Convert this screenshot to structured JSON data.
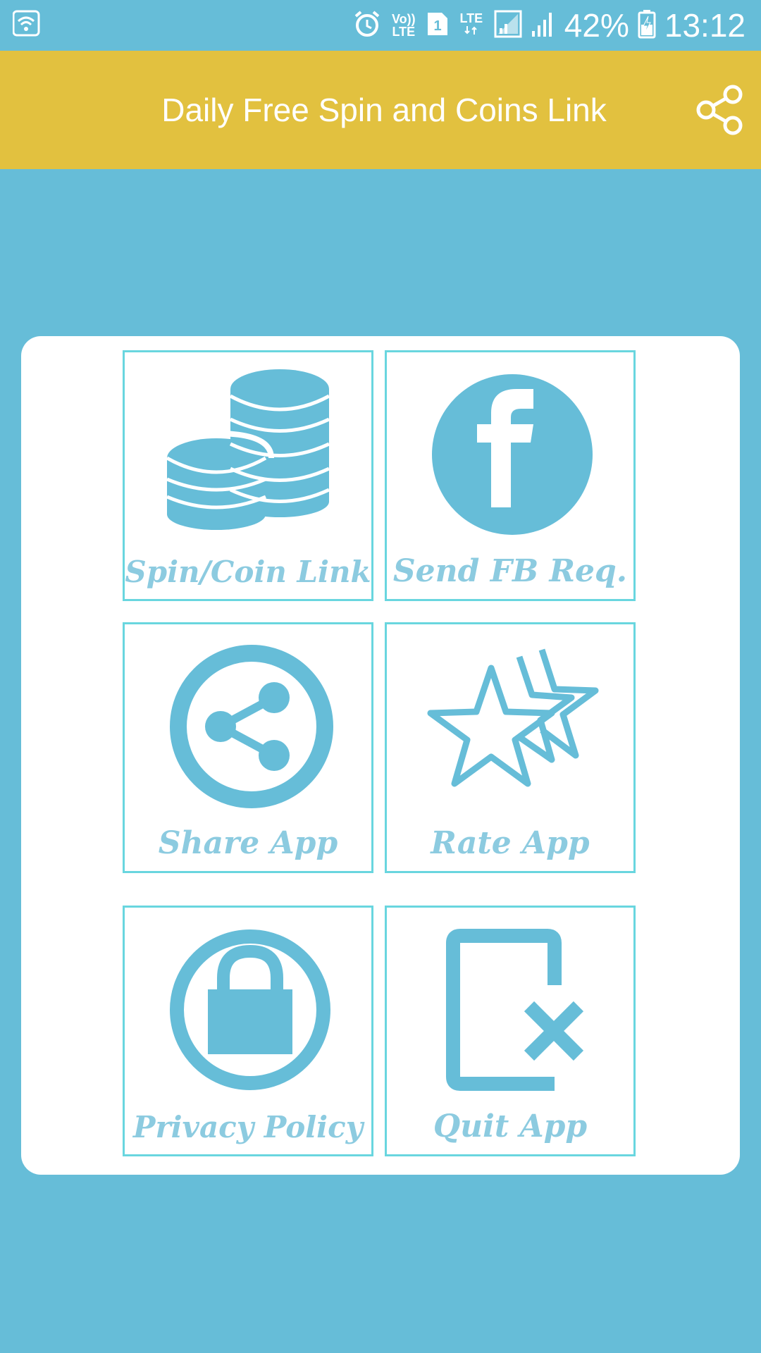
{
  "status_bar": {
    "network_label_top": "Vo))",
    "network_label_bottom": "LTE",
    "sim_slot": "1",
    "lte_label": "LTE",
    "battery_percent": "42%",
    "time": "13:12"
  },
  "app_bar": {
    "title": "Daily Free Spin and Coins Link",
    "share_icon": "share-icon"
  },
  "menu": {
    "items": [
      {
        "label": "Spin/Coin Link",
        "icon": "coins-icon"
      },
      {
        "label": "Send FB Req.",
        "icon": "facebook-icon"
      },
      {
        "label": "Share App",
        "icon": "share-circle-icon"
      },
      {
        "label": "Rate App",
        "icon": "stars-icon"
      },
      {
        "label": "Privacy Policy",
        "icon": "lock-icon"
      },
      {
        "label": "Quit App",
        "icon": "exit-icon"
      }
    ]
  },
  "colors": {
    "background": "#66bdd8",
    "app_bar": "#e2c13f",
    "card": "#ffffff",
    "tile_border": "#69d6df",
    "icon": "#66bdd8",
    "label": "#8ccbe0"
  }
}
